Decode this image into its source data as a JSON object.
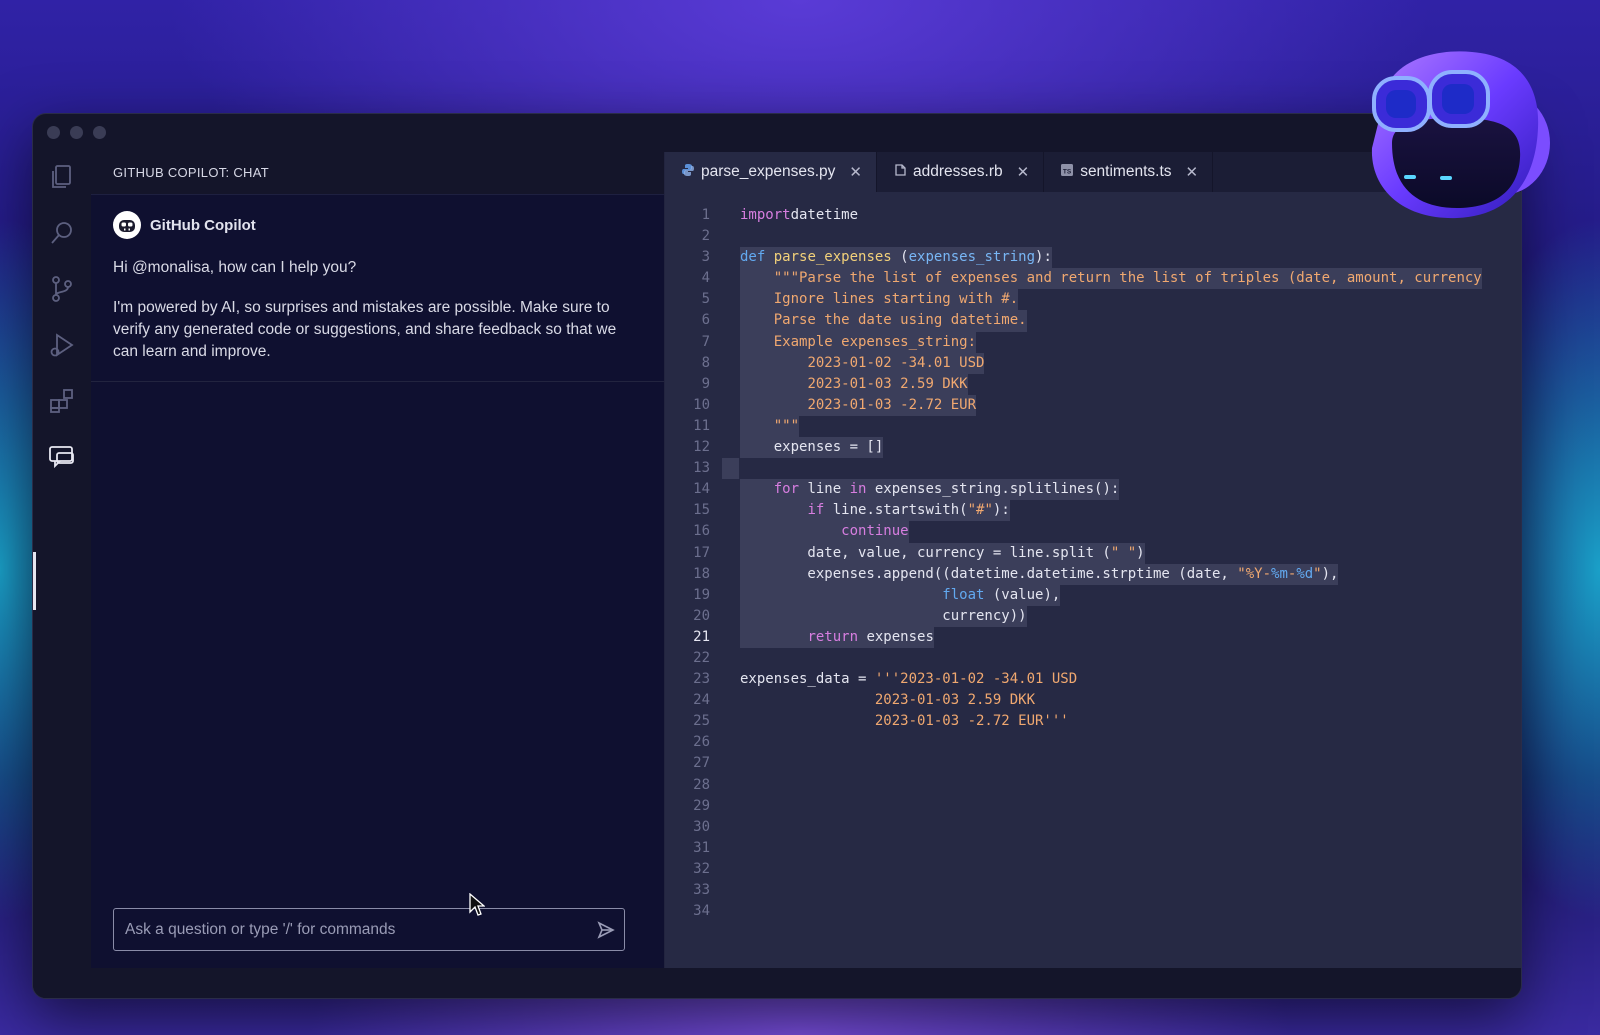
{
  "chat": {
    "header": "GITHUB COPILOT: CHAT",
    "bot_name": "GitHub Copilot",
    "greeting": "Hi @monalisa, how can I help you?",
    "disclaimer": "I'm powered by AI, so surprises and mistakes are possible. Make sure to verify any generated code or suggestions, and share feedback so that we can learn and improve.",
    "input_placeholder": "Ask a question or type '/' for commands"
  },
  "tabs": [
    {
      "label": "parse_expenses.py",
      "icon": "python-file-icon",
      "active": true
    },
    {
      "label": "addresses.rb",
      "icon": "ruby-file-icon",
      "active": false
    },
    {
      "label": "sentiments.ts",
      "icon": "typescript-file-icon",
      "active": false
    }
  ],
  "editor": {
    "current_line": 21,
    "line_numbers": [
      "1",
      "2",
      "3",
      "4",
      "5",
      "6",
      "7",
      "8",
      "9",
      "10",
      "11",
      "12",
      "13",
      "14",
      "15",
      "16",
      "17",
      "18",
      "19",
      "20",
      "21",
      "22",
      "23",
      "24",
      "25",
      "26",
      "27",
      "28",
      "29",
      "30",
      "31",
      "32",
      "33",
      "34"
    ],
    "lines": [
      [
        [
          "kw",
          "import"
        ],
        [
          "",
          "datetime"
        ]
      ],
      [],
      [
        [
          "def",
          "def"
        ],
        [
          "",
          " "
        ],
        [
          "fn",
          "parse_expenses"
        ],
        [
          "",
          " ("
        ],
        [
          "param",
          "expenses_string"
        ],
        [
          "",
          "):"
        ]
      ],
      [
        [
          "",
          "    "
        ],
        [
          "str",
          "\"\"\"Parse the list of expenses and return the list of triples (date, amount, currency"
        ]
      ],
      [
        [
          "",
          "    "
        ],
        [
          "str",
          "Ignore lines starting with #."
        ]
      ],
      [
        [
          "",
          "    "
        ],
        [
          "str",
          "Parse the date using datetime."
        ]
      ],
      [
        [
          "",
          "    "
        ],
        [
          "str",
          "Example expenses_string:"
        ]
      ],
      [
        [
          "",
          "        "
        ],
        [
          "str",
          "2023-01-02 -34.01 USD"
        ]
      ],
      [
        [
          "",
          "        "
        ],
        [
          "str",
          "2023-01-03 2.59 DKK"
        ]
      ],
      [
        [
          "",
          "        "
        ],
        [
          "str",
          "2023-01-03 -2.72 EUR"
        ]
      ],
      [
        [
          "",
          "    "
        ],
        [
          "str",
          "\"\"\""
        ]
      ],
      [
        [
          "",
          "    expenses = []"
        ]
      ],
      [],
      [
        [
          "",
          "    "
        ],
        [
          "kw",
          "for"
        ],
        [
          "",
          " line "
        ],
        [
          "kw",
          "in"
        ],
        [
          "",
          " expenses_string.splitlines():"
        ]
      ],
      [
        [
          "",
          "        "
        ],
        [
          "kw",
          "if"
        ],
        [
          "",
          " line.startswith("
        ],
        [
          "str",
          "\"#\""
        ],
        [
          "",
          "):"
        ]
      ],
      [
        [
          "",
          "            "
        ],
        [
          "kw",
          "continue"
        ]
      ],
      [
        [
          "",
          "        date, value, currency = line.split ("
        ],
        [
          "str",
          "\" \""
        ],
        [
          "",
          ")"
        ]
      ],
      [
        [
          "",
          "        expenses.append((datetime.datetime.strptime (date, "
        ],
        [
          "str",
          "\"%Y-"
        ],
        [
          "fmt",
          "%m"
        ],
        [
          "str",
          "-"
        ],
        [
          "fmt",
          "%d"
        ],
        [
          "str",
          "\""
        ],
        [
          "",
          "),"
        ]
      ],
      [
        [
          "",
          "                        "
        ],
        [
          "def",
          "float"
        ],
        [
          "",
          " (value),"
        ]
      ],
      [
        [
          "",
          "                        currency))"
        ]
      ],
      [
        [
          "",
          "        "
        ],
        [
          "kw",
          "return"
        ],
        [
          "",
          " expenses"
        ]
      ],
      [],
      [
        [
          "",
          "expenses_data = "
        ],
        [
          "str",
          "'''2023-01-02 -34.01 USD"
        ]
      ],
      [
        [
          "",
          "                "
        ],
        [
          "str",
          "2023-01-03 2.59 DKK"
        ]
      ],
      [
        [
          "",
          "                "
        ],
        [
          "str",
          "2023-01-03 -2.72 EUR'''"
        ]
      ],
      [],
      [],
      [],
      [],
      [],
      [],
      [],
      [],
      []
    ]
  },
  "colors": {
    "keyword": "#d77ee0",
    "function": "#f2d17a",
    "string": "#f0a870",
    "parameter": "#78b6f5",
    "selection": "#3b3e5a"
  }
}
